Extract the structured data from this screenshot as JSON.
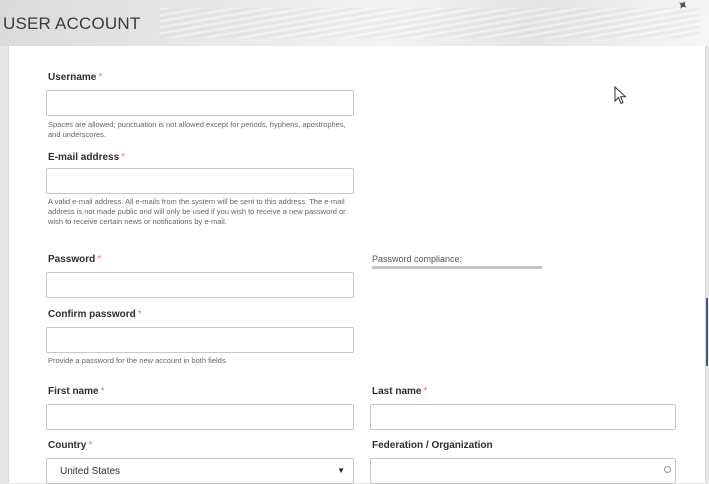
{
  "header": {
    "title": "USER ACCOUNT"
  },
  "form": {
    "required_marker": "*",
    "username": {
      "label": "Username",
      "value": "",
      "help": "Spaces are allowed; punctuation is not allowed except for periods, hyphens, apostrophes, and underscores."
    },
    "email": {
      "label": "E-mail address",
      "value": "",
      "help": "A valid e-mail address. All e-mails from the system will be sent to this address. The e-mail address is not made public and will only be used if you wish to receive a new password or wish to receive certain news or notifications by e-mail."
    },
    "password": {
      "label": "Password",
      "value": ""
    },
    "password_compliance": {
      "label": "Password compliance:",
      "level": 0
    },
    "confirm_password": {
      "label": "Confirm password",
      "value": "",
      "help": "Provide a password for the new account in both fields."
    },
    "first_name": {
      "label": "First name",
      "value": ""
    },
    "last_name": {
      "label": "Last name",
      "value": ""
    },
    "country": {
      "label": "Country",
      "selected": "United States"
    },
    "federation": {
      "label": "Federation / Organization",
      "value": ""
    }
  },
  "icons": {
    "cursor": "mouse-pointer-icon",
    "dropdown": "chevron-down-icon",
    "federation_status": "circle-icon"
  },
  "colors": {
    "required": "#e07a7a",
    "border": "#c8c8c8",
    "compliance_bar": "#c4c4c4"
  }
}
